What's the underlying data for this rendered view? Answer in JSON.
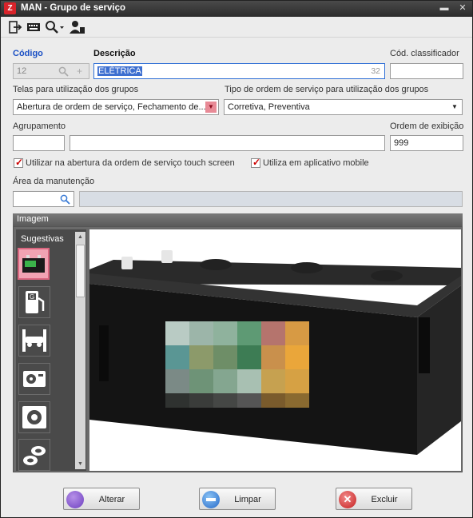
{
  "window": {
    "title": "MAN - Grupo de serviço",
    "app_badge": "Z"
  },
  "toolbar": {
    "icons": [
      "exit-icon",
      "keyboard-icon",
      "search-icon",
      "user-icon"
    ]
  },
  "form": {
    "codigo": {
      "label": "Código",
      "value": "12"
    },
    "descricao": {
      "label": "Descrição",
      "value": "ELÉTRICA",
      "counter": "32"
    },
    "cod_classificador": {
      "label": "Cód. classificador",
      "value": ""
    },
    "telas": {
      "label": "Telas para utilização dos grupos",
      "value": "Abertura de ordem de serviço, Fechamento de..."
    },
    "tipo_os": {
      "label": "Tipo de ordem de serviço para utilização dos grupos",
      "value": "Corretiva, Preventiva"
    },
    "agrupamento": {
      "label": "Agrupamento",
      "value": ""
    },
    "ordem_exibicao": {
      "label": "Ordem de exibição",
      "value": "999"
    },
    "touch_screen": {
      "label": "Utilizar na abertura da ordem de serviço touch screen",
      "checked": true
    },
    "mobile": {
      "label": "Utiliza em aplicativo mobile",
      "checked": true
    },
    "area_manutencao": {
      "label": "Área da manutenção",
      "value": ""
    }
  },
  "imagem": {
    "section_title": "Imagem",
    "sugestivas_title": "Sugestivas",
    "items": [
      "battery-icon",
      "fuel-pump-icon",
      "vehicle-lift-icon",
      "ac-unit-icon",
      "radiator-fan-icon",
      "tires-icon"
    ],
    "selected_index": 0
  },
  "buttons": {
    "alterar": "Alterar",
    "limpar": "Limpar",
    "excluir": "Excluir"
  },
  "colors": {
    "accent_blue": "#1a4fc4",
    "selected_pink": "#f1a3b3",
    "title_bar": "#2c2c2c"
  }
}
